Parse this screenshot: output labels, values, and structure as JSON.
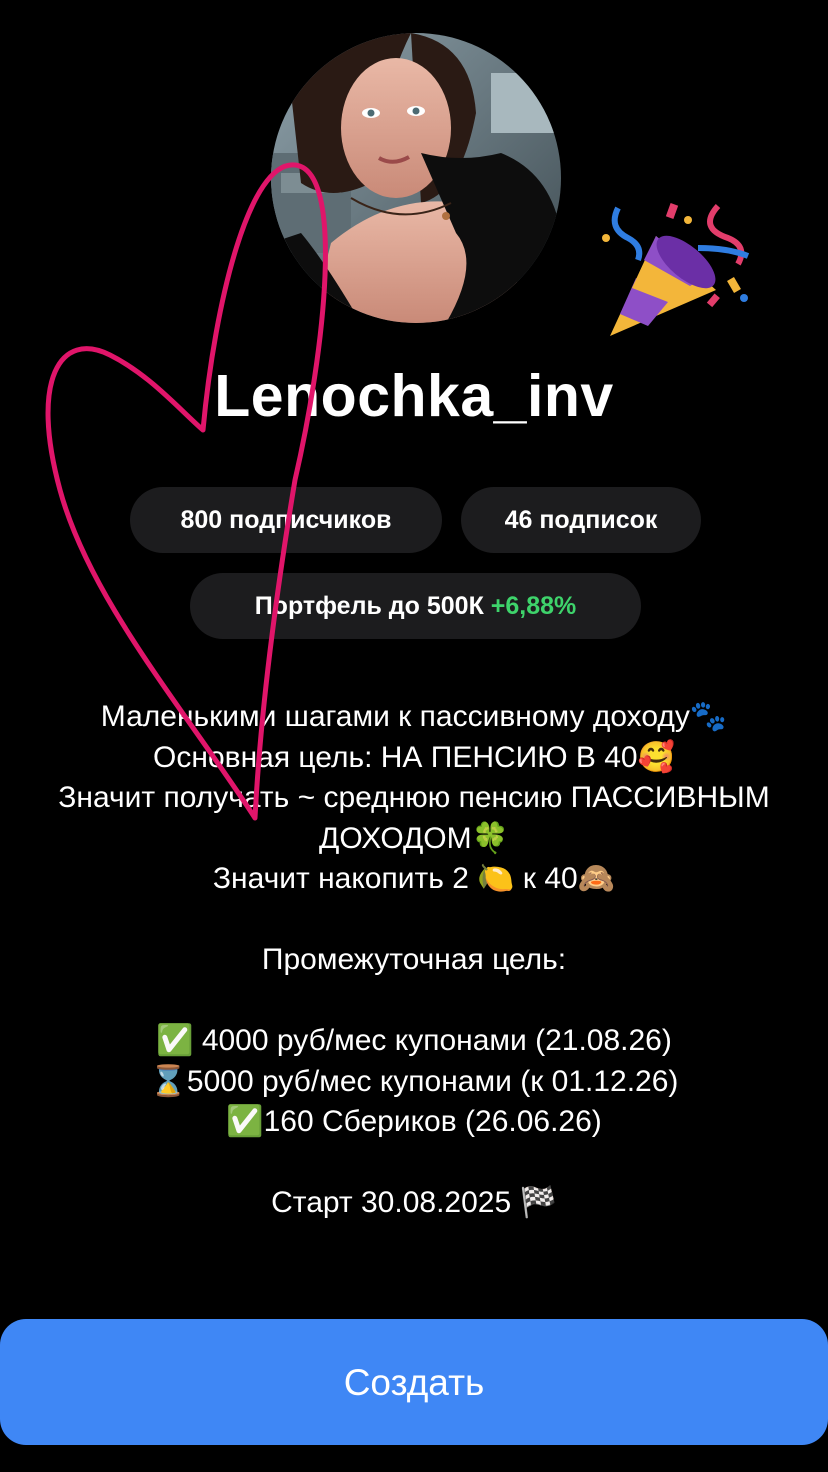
{
  "profile": {
    "username": "Lenochka_inv",
    "followers_label": "800 подписчиков",
    "following_label": "46 подписок",
    "portfolio_label": "Портфель до 500К",
    "portfolio_change": "+6,88%"
  },
  "bio": {
    "line1": "Маленькими шагами к пассивному доходу🐾",
    "line2": "Основная цель: НА ПЕНСИЮ В 40🥰",
    "line3": "Значит получать ~ среднюю пенсию ПАССИВНЫМ",
    "line4": "ДОХОДОМ🍀",
    "line5": "Значит накопить 2 🍋 к 40🙈",
    "line6": "Промежуточная цель:",
    "line7": "✅ 4000 руб/мес купонами (21.08.26)",
    "line8": "⌛5000 руб/мес купонами (к 01.12.26)",
    "line9": "✅160 Сбериков (26.06.26)",
    "line10": "Старт 30.08.2025 🏁"
  },
  "actions": {
    "create_label": "Создать"
  },
  "colors": {
    "background": "#000000",
    "pill": "#1c1c1e",
    "accent_green": "#3ed36b",
    "button_blue": "#3f87f5",
    "heart_stroke": "#e0156a"
  },
  "icons": {
    "party": "party-popper-icon"
  }
}
